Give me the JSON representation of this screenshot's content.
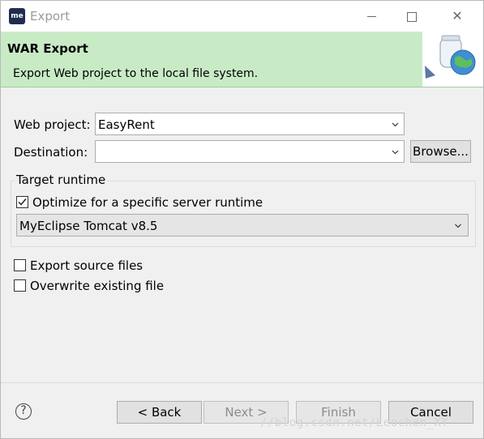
{
  "window": {
    "app_icon_text": "me",
    "title": "Export",
    "controls": {
      "minimize_icon": "minimize-icon",
      "maximize_icon": "maximize-icon",
      "close_icon": "close-icon",
      "close_glyph": "✕"
    }
  },
  "banner": {
    "title": "WAR Export",
    "description": "Export Web project to the local file system.",
    "image_icon": "export-jar-globe-icon",
    "background": "#c8ebc6"
  },
  "form": {
    "web_project": {
      "label": "Web project:",
      "value": "EasyRent"
    },
    "destination": {
      "label": "Destination:",
      "value": "",
      "browse_label": "Browse..."
    }
  },
  "target_runtime": {
    "group_label": "Target runtime",
    "optimize": {
      "label": "Optimize for a specific server runtime",
      "checked": true
    },
    "runtime_selected": "MyEclipse Tomcat v8.5"
  },
  "options": {
    "export_source": {
      "label": "Export source files",
      "checked": false
    },
    "overwrite": {
      "label": "Overwrite existing file",
      "checked": false
    }
  },
  "footer": {
    "help_glyph": "?",
    "back_label": "< Back",
    "next_label": "Next >",
    "finish_label": "Finish",
    "cancel_label": "Cancel",
    "next_enabled": false,
    "finish_enabled": false
  },
  "watermark": "//blog.csdn.net/Leochen_XY"
}
